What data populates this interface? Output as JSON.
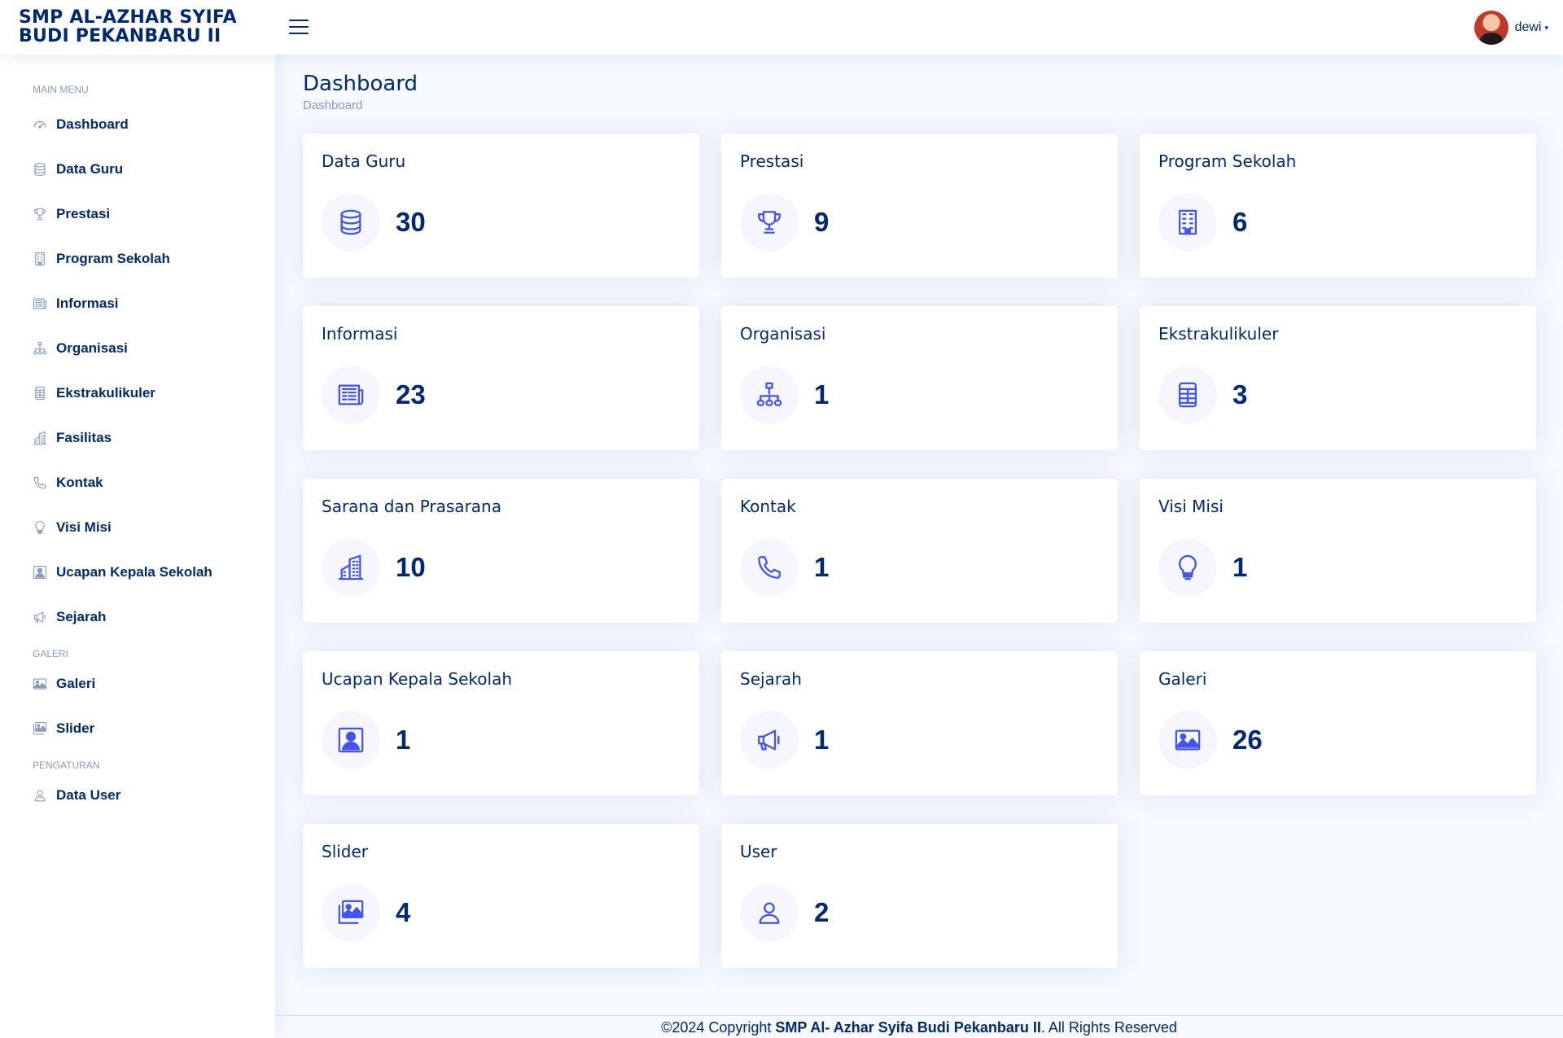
{
  "brand": {
    "line1": "SMP AL-AZHAR SYIFA",
    "line2": "BUDI PEKANBARU II"
  },
  "profile": {
    "name": "dewi",
    "caret": "▾"
  },
  "colors": {
    "accent": "#4154f1",
    "text": "#012970",
    "muted": "#899bbd",
    "background": "#f6f9ff"
  },
  "sidebar": {
    "sections": [
      {
        "heading": "MAIN MENU",
        "items": [
          {
            "label": "Dashboard",
            "icon": "speedometer-icon"
          },
          {
            "label": "Data Guru",
            "icon": "database-icon"
          },
          {
            "label": "Prestasi",
            "icon": "trophy-icon"
          },
          {
            "label": "Program Sekolah",
            "icon": "building-icon"
          },
          {
            "label": "Informasi",
            "icon": "newspaper-icon"
          },
          {
            "label": "Organisasi",
            "icon": "diagram-icon"
          },
          {
            "label": "Ekstrakulikuler",
            "icon": "calculator-icon"
          },
          {
            "label": "Fasilitas",
            "icon": "buildings-icon"
          },
          {
            "label": "Kontak",
            "icon": "telephone-icon"
          },
          {
            "label": "Visi Misi",
            "icon": "lightbulb-icon"
          },
          {
            "label": "Ucapan Kepala Sekolah",
            "icon": "person-square-icon"
          },
          {
            "label": "Sejarah",
            "icon": "megaphone-icon"
          }
        ]
      },
      {
        "heading": "GALERI",
        "items": [
          {
            "label": "Galeri",
            "icon": "image-icon"
          },
          {
            "label": "Slider",
            "icon": "images-icon"
          }
        ]
      },
      {
        "heading": "PENGATURAN",
        "items": [
          {
            "label": "Data User",
            "icon": "person-icon"
          }
        ]
      }
    ]
  },
  "page": {
    "title": "Dashboard",
    "breadcrumb": "Dashboard"
  },
  "cards": [
    {
      "title": "Data Guru",
      "value": "30",
      "icon": "database-icon"
    },
    {
      "title": "Prestasi",
      "value": "9",
      "icon": "trophy-icon"
    },
    {
      "title": "Program Sekolah",
      "value": "6",
      "icon": "building-icon"
    },
    {
      "title": "Informasi",
      "value": "23",
      "icon": "newspaper-icon"
    },
    {
      "title": "Organisasi",
      "value": "1",
      "icon": "diagram-icon"
    },
    {
      "title": "Ekstrakulikuler",
      "value": "3",
      "icon": "calculator-icon"
    },
    {
      "title": "Sarana dan Prasarana",
      "value": "10",
      "icon": "buildings-icon"
    },
    {
      "title": "Kontak",
      "value": "1",
      "icon": "telephone-icon"
    },
    {
      "title": "Visi Misi",
      "value": "1",
      "icon": "lightbulb-icon"
    },
    {
      "title": "Ucapan Kepala Sekolah",
      "value": "1",
      "icon": "person-square-icon"
    },
    {
      "title": "Sejarah",
      "value": "1",
      "icon": "megaphone-icon"
    },
    {
      "title": "Galeri",
      "value": "26",
      "icon": "image-icon"
    },
    {
      "title": "Slider",
      "value": "4",
      "icon": "images-icon"
    },
    {
      "title": "User",
      "value": "2",
      "icon": "person-icon"
    }
  ],
  "footer": {
    "prefix": "©2024 Copyright ",
    "owner": "SMP Al- Azhar Syifa Budi Pekanbaru II",
    "suffix": ". All Rights Reserved"
  },
  "back_to_top_icon": "arrow-up-icon"
}
